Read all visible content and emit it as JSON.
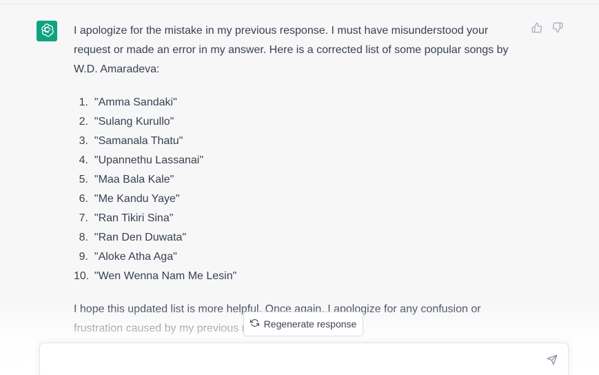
{
  "message": {
    "intro": "I apologize for the mistake in my previous response. I must have misunderstood your request or made an error in my answer. Here is a corrected list of some popular songs by W.D. Amaradeva:",
    "intro_lines": [
      "I apologize for the mistake in my previous response. I must have misunderstood your",
      "request or made an error in my answer. Here is a corrected list of some popular songs by",
      "W.D. Amaradeva:"
    ],
    "songs": [
      {
        "num": "1.",
        "title": "\"Amma Sandaki\""
      },
      {
        "num": "2.",
        "title": "\"Sulang Kurullo\""
      },
      {
        "num": "3.",
        "title": "\"Samanala Thatu\""
      },
      {
        "num": "4.",
        "title": "\"Upannethu Lassanai\""
      },
      {
        "num": "5.",
        "title": "\"Maa Bala Kale\""
      },
      {
        "num": "6.",
        "title": "\"Me Kandu Yaye\""
      },
      {
        "num": "7.",
        "title": "\"Ran Tikiri Sina\""
      },
      {
        "num": "8.",
        "title": "\"Ran Den Duwata\""
      },
      {
        "num": "9.",
        "title": "\"Aloke Atha Aga\""
      },
      {
        "num": "10.",
        "title": "\"Wen Wenna Nam Me Lesin\""
      }
    ],
    "outro_lines": [
      "I hope this updated list is more helpful. Once again, I apologize for any confusion or",
      "frustration caused by my previous response."
    ]
  },
  "regenerate": {
    "label": "Regenerate response"
  },
  "composer": {
    "value": "",
    "placeholder": ""
  },
  "icons": {
    "avatar": "openai-logo-icon",
    "thumbs_up": "thumbs-up-icon",
    "thumbs_down": "thumbs-down-icon",
    "regenerate": "refresh-icon",
    "send": "send-icon"
  },
  "colors": {
    "avatar_bg": "#10a37f",
    "page_bg": "#f7f7f8",
    "text": "#374151",
    "icon": "#acacbe"
  }
}
